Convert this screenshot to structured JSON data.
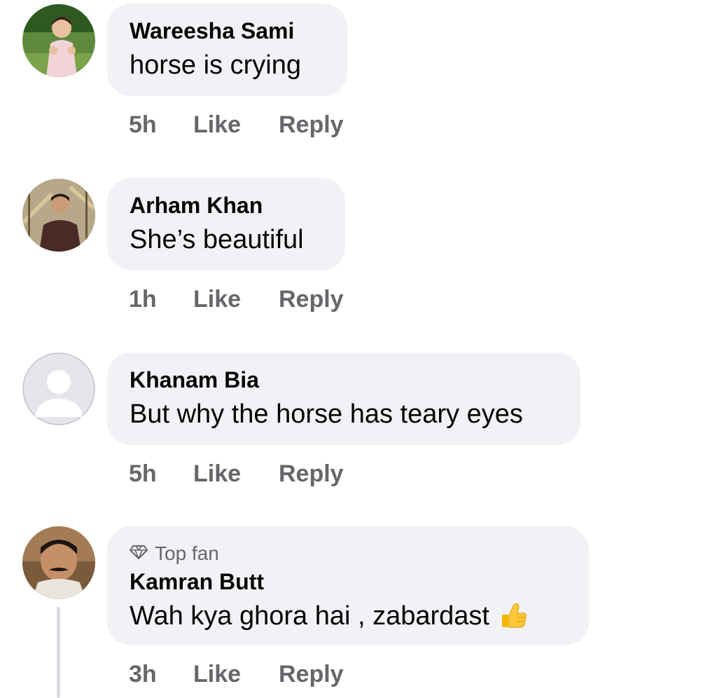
{
  "comments": [
    {
      "author": "Wareesha Sami",
      "text": "horse is crying",
      "time": "5h",
      "like_label": "Like",
      "reply_label": "Reply",
      "avatar": "photo-girl-avatar"
    },
    {
      "author": "Arham Khan",
      "text": "She’s beautiful",
      "time": "1h",
      "like_label": "Like",
      "reply_label": "Reply",
      "avatar": "photo-man-avatar"
    },
    {
      "author": "Khanam Bia",
      "text": "But why the horse has teary eyes",
      "time": "5h",
      "like_label": "Like",
      "reply_label": "Reply",
      "avatar": "default-profile-avatar"
    },
    {
      "badge": "Top fan",
      "badge_icon": "diamond-icon",
      "author": "Kamran Butt",
      "text": "Wah kya ghora hai , zabardast",
      "emoji": "thumbs-up-icon",
      "time": "3h",
      "like_label": "Like",
      "reply_label": "Reply",
      "avatar": "photo-man-mustache-avatar"
    }
  ],
  "colors": {
    "bubble": "#f0f2f5",
    "author_text": "#050505",
    "meta_text": "#65676b",
    "thread_line": "#dadde1"
  }
}
